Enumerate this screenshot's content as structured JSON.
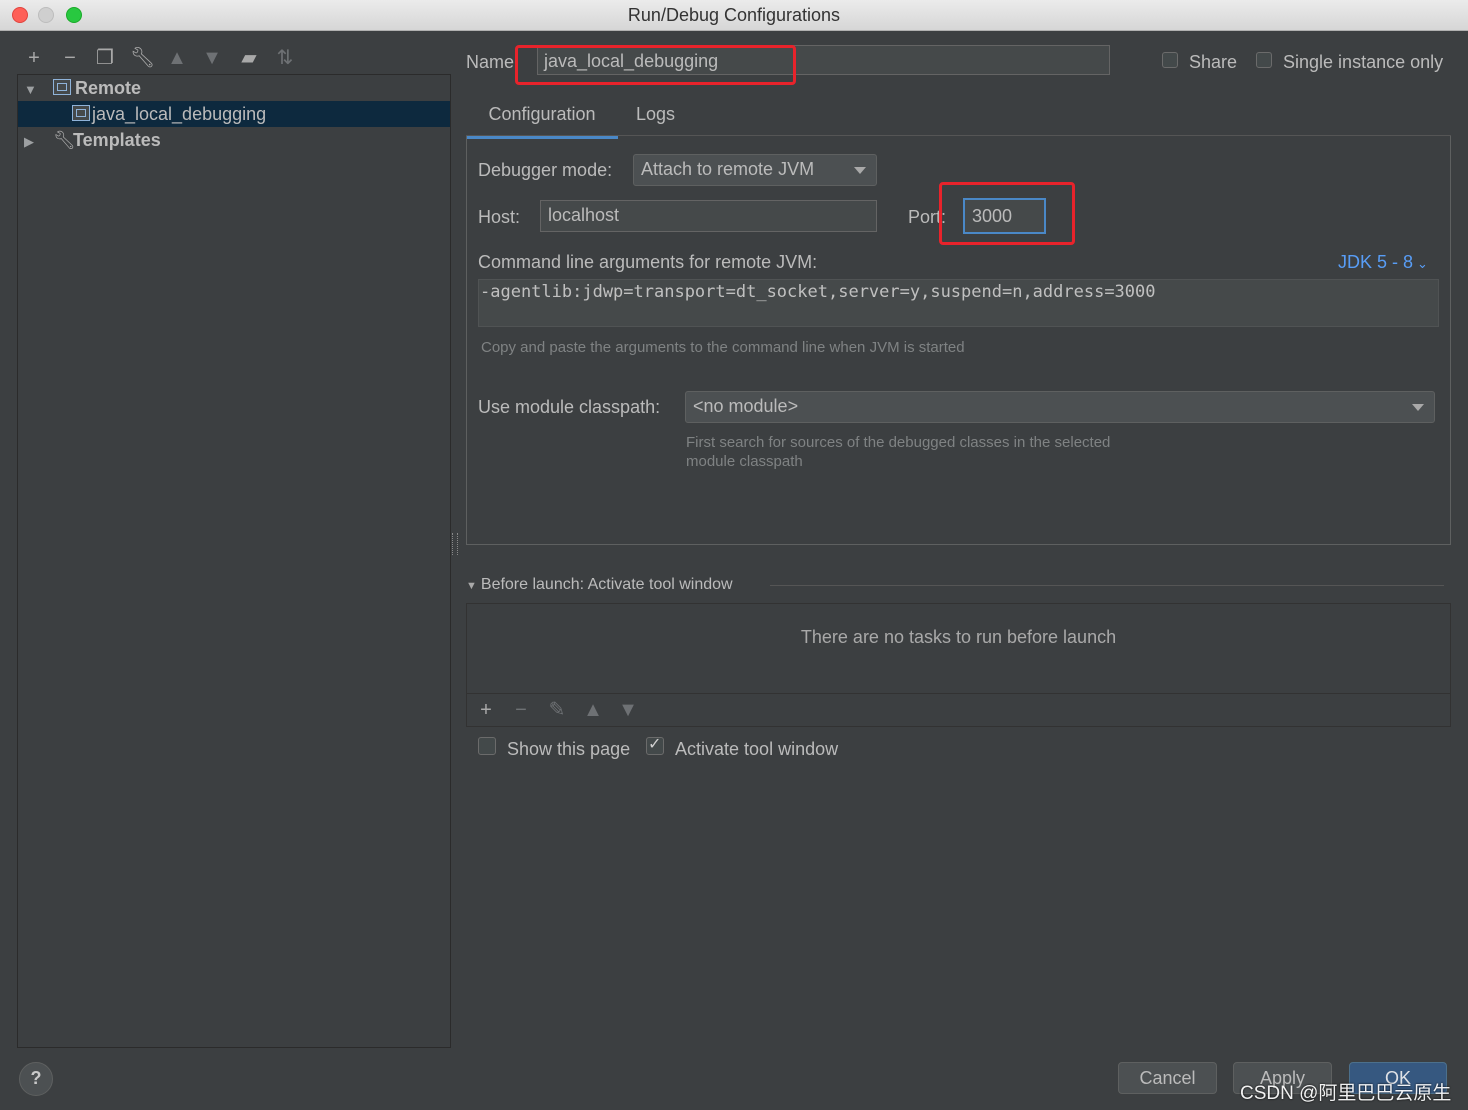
{
  "window": {
    "title": "Run/Debug Configurations"
  },
  "toolbar": {
    "icons": [
      "add-icon",
      "remove-icon",
      "copy-icon",
      "wrench-icon",
      "move-up-icon",
      "move-down-icon",
      "new-folder-icon",
      "sort-icon"
    ]
  },
  "tree": {
    "remote_label": "Remote",
    "config_label": "java_local_debugging",
    "templates_label": "Templates"
  },
  "header": {
    "name_label": "Name:",
    "name_value": "java_local_debugging",
    "share_label": "Share",
    "single_instance_label": "Single instance only"
  },
  "tabs": [
    {
      "label": "Configuration"
    },
    {
      "label": "Logs"
    }
  ],
  "config": {
    "debugger_mode_label": "Debugger mode:",
    "debugger_mode_value": "Attach to remote JVM",
    "host_label": "Host:",
    "host_value": "localhost",
    "port_label": "Port:",
    "port_value": "3000",
    "cmdline_label": "Command line arguments for remote JVM:",
    "jdk_link": "JDK 5 - 8",
    "cmdline_value": "-agentlib:jdwp=transport=dt_socket,server=y,suspend=n,address=3000",
    "cmdline_hint": "Copy and paste the arguments to the command line when JVM is started",
    "module_label": "Use module classpath:",
    "module_value": "<no module>",
    "module_hint_line1": "First search for sources of the debugged classes in the selected",
    "module_hint_line2": "module classpath"
  },
  "before_launch": {
    "title": "Before launch: Activate tool window",
    "empty_text": "There are no tasks to run before launch",
    "show_page_label": "Show this page",
    "activate_label": "Activate tool window"
  },
  "buttons": {
    "help": "?",
    "cancel": "Cancel",
    "apply": "Apply",
    "ok": "OK"
  },
  "watermark": "CSDN @阿里巴巴云原生",
  "colors": {
    "background": "#3c3f41",
    "accent": "#4a88c7",
    "highlight": "#e8232b",
    "link": "#589df6"
  }
}
